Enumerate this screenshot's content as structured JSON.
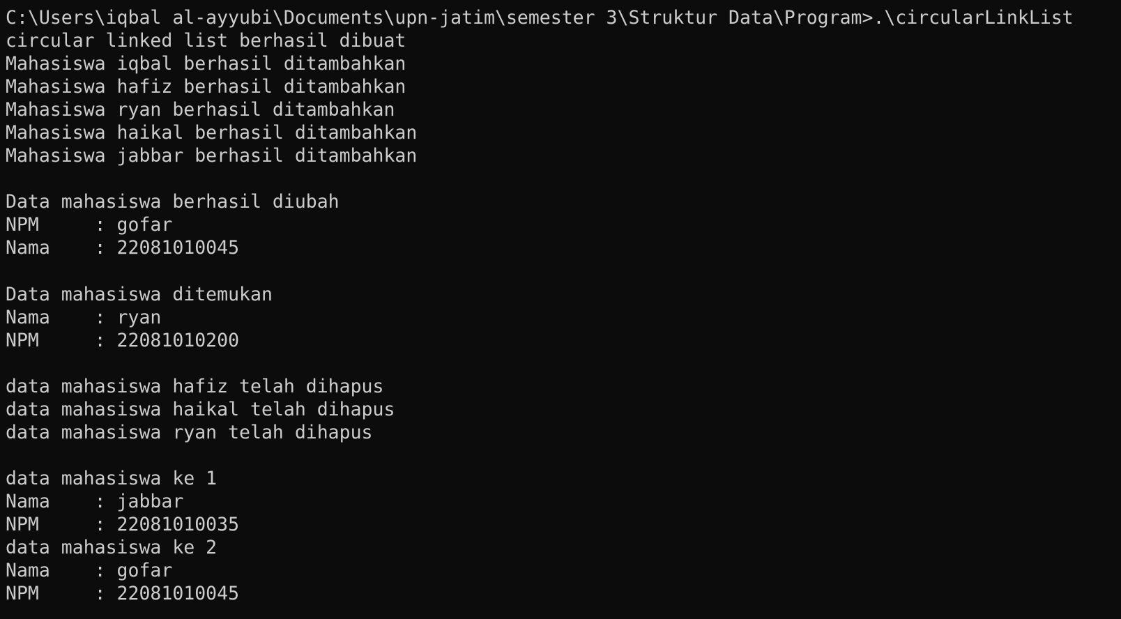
{
  "terminal": {
    "prompt": {
      "path": "C:\\Users\\iqbal al-ayyubi\\Documents\\upn-jatim\\semester 3\\Struktur Data\\Program>",
      "command": ".\\circularLinkList"
    },
    "output": {
      "created": "circular linked list berhasil dibuat",
      "added": [
        "Mahasiswa iqbal berhasil ditambahkan",
        "Mahasiswa hafiz berhasil ditambahkan",
        "Mahasiswa ryan berhasil ditambahkan",
        "Mahasiswa haikal berhasil ditambahkan",
        "Mahasiswa jabbar berhasil ditambahkan"
      ],
      "update": {
        "message": "Data mahasiswa berhasil diubah",
        "npm_line": "NPM     : gofar",
        "nama_line": "Nama    : 22081010045"
      },
      "search": {
        "message": "Data mahasiswa ditemukan",
        "nama_line": "Nama    : ryan",
        "npm_line": "NPM     : 22081010200"
      },
      "deleted": [
        "data mahasiswa hafiz telah dihapus",
        "data mahasiswa haikal telah dihapus",
        "data mahasiswa ryan telah dihapus"
      ],
      "records": [
        {
          "header": "data mahasiswa ke 1",
          "nama_line": "Nama    : jabbar",
          "npm_line": "NPM     : 22081010035"
        },
        {
          "header": "data mahasiswa ke 2",
          "nama_line": "Nama    : gofar",
          "npm_line": "NPM     : 22081010045"
        }
      ]
    },
    "colors": {
      "background": "#0c0c0c",
      "foreground": "#cccccc"
    }
  }
}
